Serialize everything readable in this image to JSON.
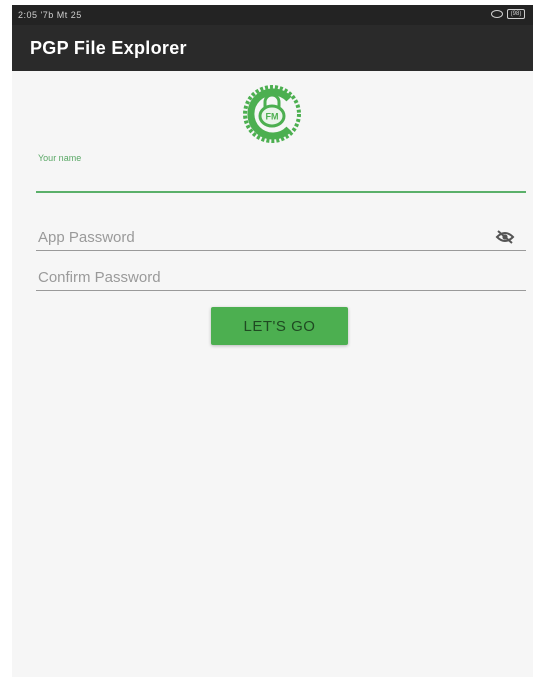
{
  "status_bar": {
    "time": "2:05 '7b Mt 25",
    "battery": "(98)",
    "icons": [
      "eye-icon",
      "battery-icon"
    ]
  },
  "app_bar": {
    "title": "PGP File Explorer"
  },
  "logo": {
    "icon": "app-logo-icon",
    "text": "FM",
    "color": "#4caf50"
  },
  "form": {
    "name": {
      "label": "Your name",
      "value": ""
    },
    "password": {
      "placeholder": "App Password",
      "value": "",
      "toggle_icon": "visibility-off-icon"
    },
    "confirm": {
      "placeholder": "Confirm Password",
      "value": ""
    },
    "submit_label": "LET'S GO"
  },
  "colors": {
    "accent": "#4caf50",
    "app_bar": "#2a2a2a",
    "status_bar": "#232323",
    "background": "#f6f6f6"
  }
}
